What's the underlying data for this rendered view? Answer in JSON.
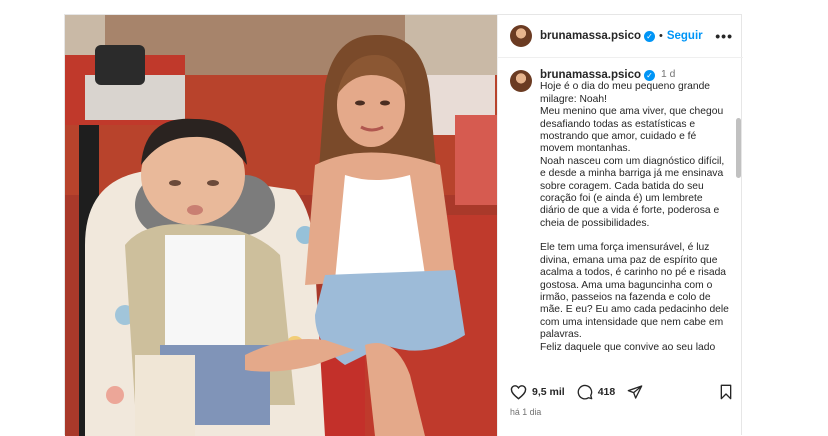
{
  "post": {
    "username": "brunamassa.psico",
    "follow_label": "Seguir",
    "more_label": "•••",
    "caption": {
      "username": "brunamassa.psico",
      "time": "1 d",
      "paragraphs": [
        "Hoje é o dia do meu pequeno grande milagre: Noah!\nMeu menino que ama viver, que chegou desafiando todas as estatísticas e mostrando que amor, cuidado e fé movem montanhas.\nNoah nasceu com um diagnóstico difícil, e desde a minha barriga já me ensinava sobre coragem. Cada batida do seu coração foi (e ainda é) um lembrete diário de que a vida é forte, poderosa e cheia de possibilidades.",
        "Ele tem uma força imensurável, é luz divina, emana uma paz de espírito que acalma a todos, é carinho no pé e risada gostosa. Ama uma baguncinha com o irmão, passeios na fazenda e colo de mãe. E eu? Eu amo cada pedacinho dele com uma intensidade que nem cabe em palavras.\nFeliz daquele que convive ao seu lado"
      ]
    },
    "likes": "9,5 mil",
    "comments_count": "418",
    "posted_ago": "há 1 dia"
  },
  "colors": {
    "accent": "#0095f6",
    "text": "#262626",
    "muted": "#737373"
  },
  "icons": {
    "like": "heart-icon",
    "comment": "comment-icon",
    "share": "share-icon",
    "save": "bookmark-icon",
    "verified": "verified-badge-icon"
  }
}
